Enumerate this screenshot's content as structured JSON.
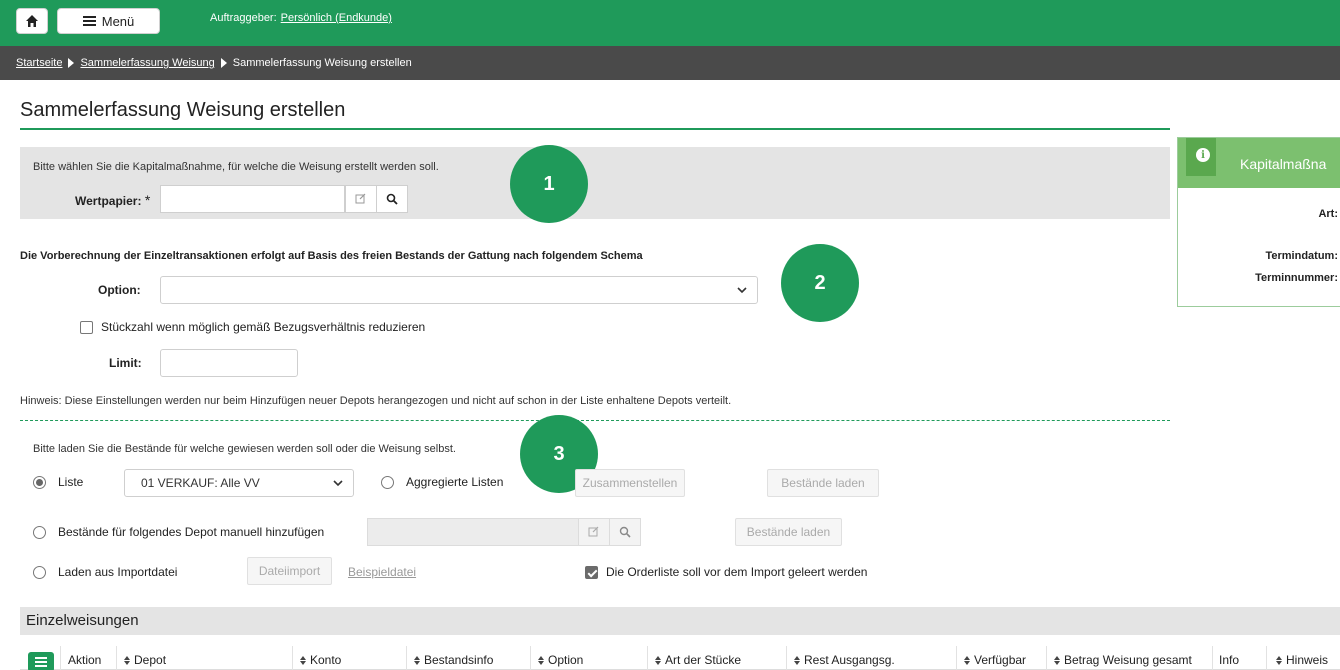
{
  "topbar": {
    "menu_label": "Menü",
    "auftraggeber_label": "Auftraggeber:",
    "auftraggeber_value": "Persönlich (Endkunde)"
  },
  "breadcrumb": [
    "Startseite",
    "Sammelerfassung Weisung",
    "Sammelerfassung Weisung erstellen"
  ],
  "page_title": "Sammelerfassung Weisung erstellen",
  "section1": {
    "hint": "Bitte wählen Sie die Kapitalmaßnahme, für welche die Weisung erstellt werden soll.",
    "wertpapier_label": "Wertpapier:",
    "required_mark": "*",
    "wertpapier_value": ""
  },
  "markers": [
    "1",
    "2",
    "3"
  ],
  "section2": {
    "description": "Die Vorberechnung der Einzeltransaktionen erfolgt auf Basis des freien Bestands der Gattung nach folgendem Schema",
    "option_label": "Option:",
    "option_value": "",
    "reduce_checkbox_label": "Stückzahl wenn möglich gemäß Bezugsverhältnis reduzieren",
    "limit_label": "Limit:",
    "limit_value": "",
    "hinweis": "Hinweis: Diese Einstellungen werden nur beim Hinzufügen neuer Depots herangezogen und nicht auf schon in der Liste enhaltene Depots verteilt."
  },
  "section3": {
    "intro": "Bitte laden Sie die Bestände für welche gewiesen werden soll oder die Weisung selbst.",
    "liste_label": "Liste",
    "liste_selected": "01 VERKAUF: Alle VV",
    "aggregierte_label": "Aggregierte Listen",
    "zusammenstellen_label": "Zusammenstellen",
    "bestaende_laden_label": "Bestände laden",
    "manuell_label": "Bestände für folgendes Depot manuell hinzufügen",
    "import_label": "Laden aus Importdatei",
    "dateiimport_label": "Dateiimport",
    "beispieldatei_label": "Beispieldatei",
    "leeren_label": "Die Orderliste soll vor dem Import geleert werden"
  },
  "einzelweisungen": {
    "title": "Einzelweisungen",
    "columns": [
      "Aktion",
      "Depot",
      "Konto",
      "Bestandsinfo",
      "Option",
      "Art der Stücke",
      "Rest Ausgangsg.",
      "Verfügbar",
      "Betrag Weisung gesamt",
      "Info",
      "Hinweis"
    ]
  },
  "info_panel": {
    "title": "Kapitalmaßna",
    "art_label": "Art:",
    "termindatum_label": "Termindatum:",
    "terminnummer_label": "Terminnummer:"
  },
  "colors": {
    "brand_green": "#1f9a5a",
    "breadcrumb_bg": "#4a4a4a",
    "panel_green": "#7cc06f"
  }
}
